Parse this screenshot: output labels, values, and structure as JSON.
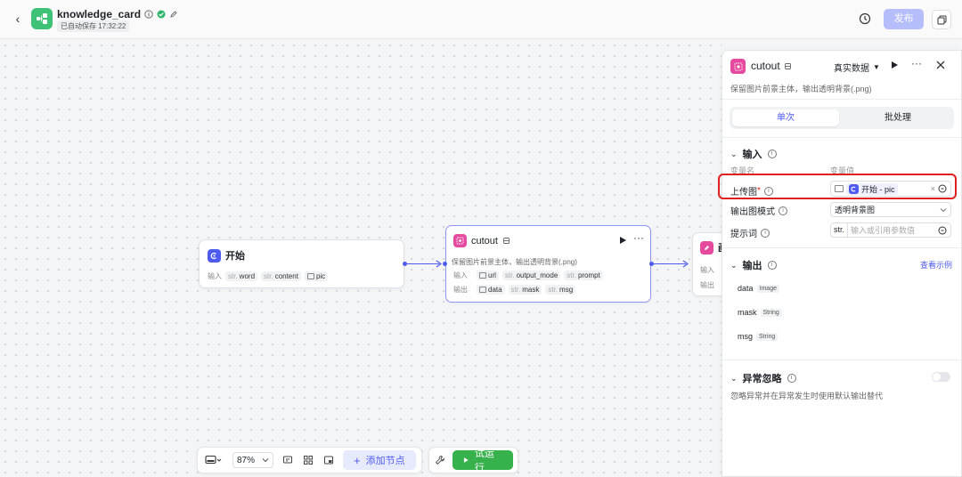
{
  "header": {
    "title": "knowledge_card",
    "autosave": "已自动保存 17:32:22",
    "publish_label": "发布"
  },
  "colors": {
    "accent": "#4e5bf0",
    "app_icon": "#3ec277",
    "run": "#36b14c",
    "cutout_icon": "#e64a9f",
    "highlight": "#e0201e"
  },
  "nodes": {
    "start": {
      "title": "开始",
      "input_label": "输入",
      "params": [
        {
          "type": "str.",
          "name": "word"
        },
        {
          "type": "str.",
          "name": "content"
        },
        {
          "type": "img",
          "name": "pic"
        }
      ]
    },
    "cutout": {
      "title": "cutout",
      "desc": "保留图片前景主体，输出透明背景(.png)",
      "input_label": "输入",
      "output_label": "输出",
      "inputs": [
        {
          "type": "img",
          "name": "url"
        },
        {
          "type": "str.",
          "name": "output_mode"
        },
        {
          "type": "str.",
          "name": "prompt"
        }
      ],
      "outputs": [
        {
          "type": "img",
          "name": "data"
        },
        {
          "type": "str.",
          "name": "mask"
        },
        {
          "type": "str.",
          "name": "msg"
        }
      ]
    },
    "next": {
      "title_partial": "画",
      "input_label": "输入",
      "output_label": "输出"
    }
  },
  "toolbar": {
    "zoom": "87%",
    "add_node_label": "添加节点",
    "run_label": "试运行"
  },
  "panel": {
    "title": "cutout",
    "mode_select": "真实数据",
    "desc": "保留图片前景主体，输出透明背景(.png)",
    "tabs": [
      "单次",
      "批处理"
    ],
    "input_section": {
      "title": "输入",
      "col_name": "变量名",
      "col_value": "变量值",
      "fields": [
        {
          "label": "上传图",
          "required": "*",
          "value_ref": "开始 - pic"
        },
        {
          "label": "输出图模式",
          "value": "透明背景图"
        },
        {
          "label": "提示词",
          "type": "str.",
          "placeholder": "输入或引用参数值"
        }
      ]
    },
    "output_section": {
      "title": "输出",
      "example_link": "查看示例",
      "outputs": [
        {
          "name": "data",
          "type": "Image"
        },
        {
          "name": "mask",
          "type": "String"
        },
        {
          "name": "msg",
          "type": "String"
        }
      ]
    },
    "exception_section": {
      "title": "异常忽略",
      "desc": "忽略异常并在异常发生时使用默认输出替代"
    }
  }
}
